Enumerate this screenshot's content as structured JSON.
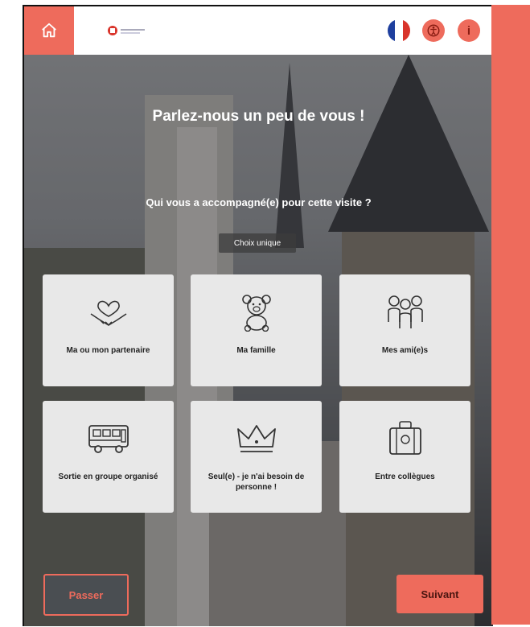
{
  "header": {
    "home_icon": "home-icon",
    "logo_icon": "brand-logo",
    "language_flag": "france-flag-icon",
    "accessibility_icon": "accessibility-icon",
    "info_label": "i"
  },
  "content": {
    "title": "Parlez-nous un peu de vous !",
    "question": "Qui vous a accompagné(e) pour cette visite ?",
    "choice_mode": "Choix unique"
  },
  "options": [
    {
      "label": "Ma ou mon partenaire",
      "icon": "handshake-heart-icon"
    },
    {
      "label": "Ma famille",
      "icon": "teddy-bear-icon"
    },
    {
      "label": "Mes ami(e)s",
      "icon": "friends-group-icon"
    },
    {
      "label": "Sortie en groupe organisé",
      "icon": "bus-icon"
    },
    {
      "label": "Seul(e) - je n'ai besoin de personne !",
      "icon": "crown-icon"
    },
    {
      "label": "Entre collègues",
      "icon": "suitcase-icon"
    }
  ],
  "nav": {
    "prev_label": "Passer",
    "next_label": "Suivant"
  },
  "colors": {
    "accent": "#ee6b5c",
    "tile_bg": "#e8e8e8"
  }
}
